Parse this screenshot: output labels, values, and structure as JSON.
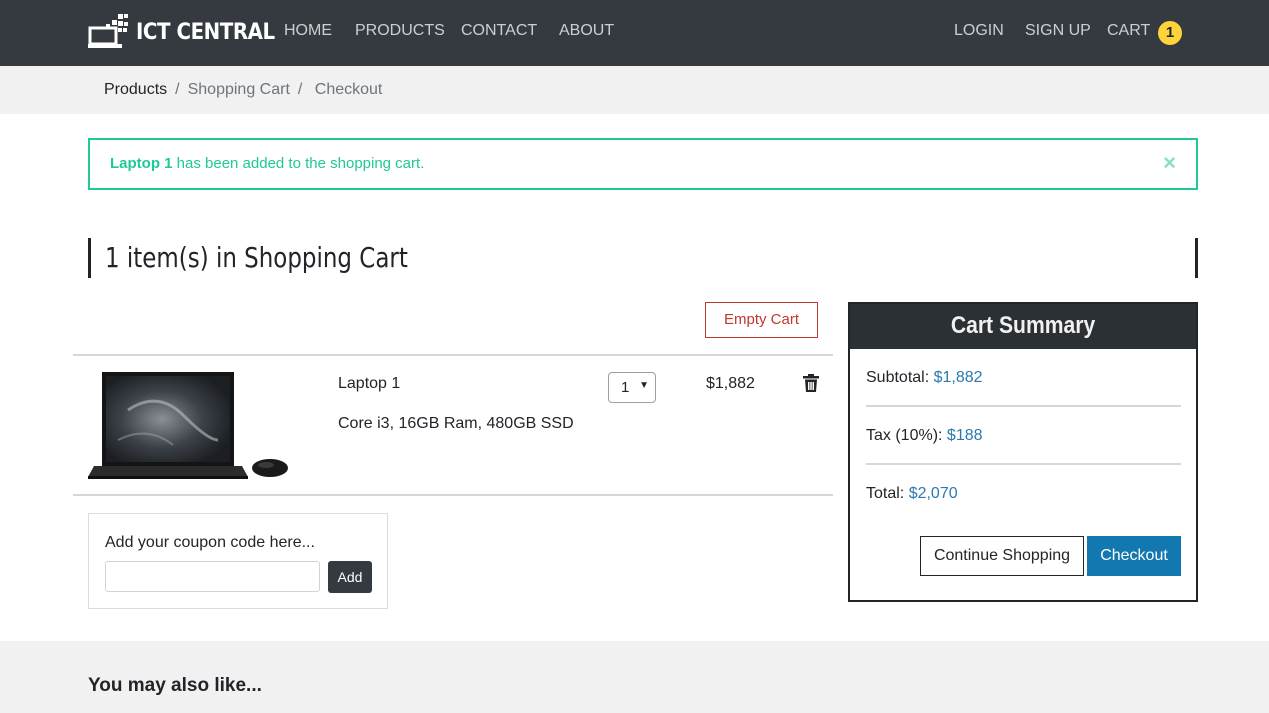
{
  "nav": {
    "brand": "ICT CENTRAL",
    "links": [
      "HOME",
      "PRODUCTS",
      "CONTACT",
      "ABOUT"
    ],
    "login": "LOGIN",
    "signup": "SIGN UP",
    "cart": "CART",
    "cart_count": "1"
  },
  "breadcrumb": [
    "Products",
    "Shopping Cart",
    "Checkout"
  ],
  "alert": {
    "product": "Laptop 1",
    "message": " has been added to the shopping cart.",
    "close": "×"
  },
  "cart": {
    "heading": "1 item(s) in Shopping Cart",
    "empty_label": "Empty Cart",
    "items": [
      {
        "name": "Laptop 1",
        "description": "Core i3, 16GB Ram, 480GB SSD",
        "quantity": "1",
        "price": "$1,882",
        "image_icon": "laptop-image"
      }
    ]
  },
  "coupon": {
    "label": "Add your coupon code here...",
    "value": "",
    "add_label": "Add"
  },
  "summary": {
    "title": "Cart Summary",
    "subtotal_label": "Subtotal: ",
    "subtotal": "$1,882",
    "tax_label": "Tax (10%): ",
    "tax": "$188",
    "total_label": "Total: ",
    "total": "$2,070",
    "continue_label": "Continue Shopping",
    "checkout_label": "Checkout"
  },
  "also_heading": "You may also like...",
  "colors": {
    "navbar": "#343a40",
    "alert": "#20c997",
    "badge": "#ffd43b",
    "danger": "#c0392b",
    "primary": "#1478b0",
    "link": "#2a7ab0"
  }
}
